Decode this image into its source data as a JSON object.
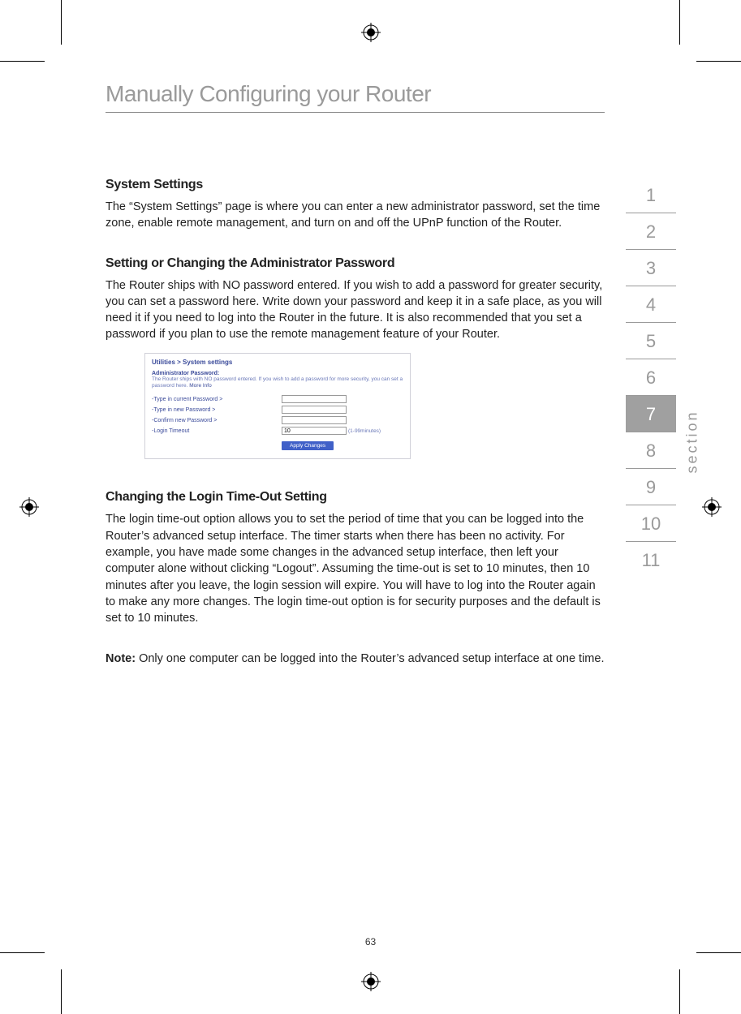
{
  "chapter_title": "Manually Configuring your Router",
  "sections": {
    "s1": {
      "heading": "System Settings",
      "body": "The “System Settings” page is where you can enter a new administrator password, set the time zone, enable remote management, and turn on and off the UPnP function of the Router."
    },
    "s2": {
      "heading": "Setting or Changing the Administrator Password",
      "body": "The Router ships with NO password entered. If you wish to add a password for greater security, you can set a password here. Write down your password and keep it in a safe place, as you will need it if you need to log into the Router in the future. It is also recommended that you set a password if you plan to use the remote management feature of your Router."
    },
    "s3": {
      "heading": "Changing the Login Time-Out Setting",
      "body": "The login time-out option allows you to set the period of time that you can be logged into the Router’s advanced setup interface. The timer starts when there has been no activity. For example, you have made some changes in the advanced setup interface, then left your computer alone without clicking “Logout”. Assuming the time-out is set to 10 minutes, then 10 minutes after you leave, the login session will expire. You will have to log into the Router again to make any more changes. The login time-out option is for security purposes and the default is set to 10 minutes."
    },
    "note_label": "Note:",
    "note_body": " Only one computer can be logged into the Router’s advanced setup interface at one time."
  },
  "screenshot": {
    "breadcrumb": "Utilities > System settings",
    "subheading": "Administrator Password:",
    "desc": "The Router ships with NO password entered. If you wish to add a password for more security, you can set a password here.",
    "more": "More Info",
    "rows": {
      "r1": "-Type in current Password >",
      "r2": "-Type in new Password >",
      "r3": "-Confirm new Password >",
      "r4": "-Login Timeout"
    },
    "timeout_value": "10",
    "timeout_hint": "(1-99minutes)",
    "apply_label": "Apply Changes"
  },
  "nav": {
    "items": [
      "1",
      "2",
      "3",
      "4",
      "5",
      "6",
      "7",
      "8",
      "9",
      "10",
      "11"
    ],
    "active_index": 6,
    "label": "section"
  },
  "page_number": "63"
}
